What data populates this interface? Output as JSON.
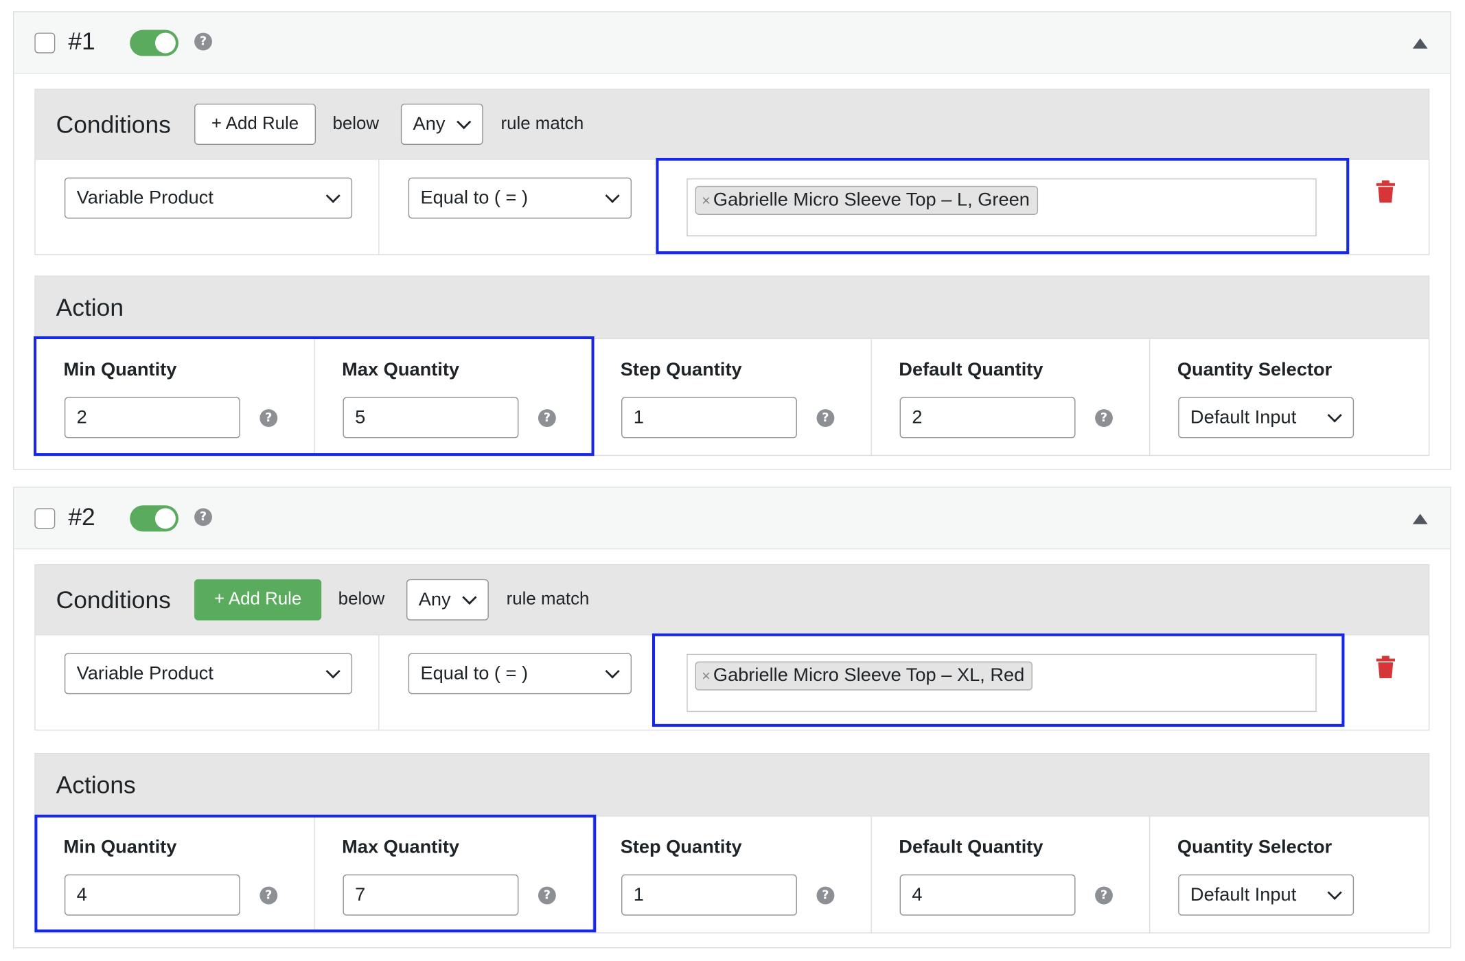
{
  "rules": [
    {
      "number": "#1",
      "enabled": true,
      "conditions": {
        "title": "Conditions",
        "add_rule_label": "+ Add Rule",
        "below_text": "below",
        "match_value": "Any",
        "rule_match_text": "rule match",
        "row": {
          "product_type": "Variable Product",
          "operator": "Equal to ( = )",
          "tags": [
            {
              "remove": "×",
              "label": "Gabrielle Micro Sleeve Top – L, Green"
            }
          ]
        }
      },
      "action": {
        "title": "Action",
        "fields": [
          {
            "label": "Min Quantity",
            "value": "2"
          },
          {
            "label": "Max Quantity",
            "value": "5"
          },
          {
            "label": "Step Quantity",
            "value": "1"
          },
          {
            "label": "Default Quantity",
            "value": "2"
          },
          {
            "label": "Quantity Selector",
            "value": "Default Input"
          }
        ]
      }
    },
    {
      "number": "#2",
      "enabled": true,
      "conditions": {
        "title": "Conditions",
        "add_rule_label": "+ Add Rule",
        "below_text": "below",
        "match_value": "Any",
        "rule_match_text": "rule match",
        "row": {
          "product_type": "Variable Product",
          "operator": "Equal to ( = )",
          "tags": [
            {
              "remove": "×",
              "label": "Gabrielle Micro Sleeve Top – XL, Red"
            }
          ]
        }
      },
      "action": {
        "title": "Actions",
        "fields": [
          {
            "label": "Min Quantity",
            "value": "4"
          },
          {
            "label": "Max Quantity",
            "value": "7"
          },
          {
            "label": "Step Quantity",
            "value": "1"
          },
          {
            "label": "Default Quantity",
            "value": "4"
          },
          {
            "label": "Quantity Selector",
            "value": "Default Input"
          }
        ]
      }
    }
  ],
  "help_glyph": "?",
  "colors": {
    "toggle_on": "#5aab5e",
    "add_rule_active": "#5aab5e",
    "highlight_border": "#1727e6",
    "delete_icon": "#d63638"
  },
  "icons": {
    "help": "question-circle-icon",
    "collapse": "triangle-up-icon",
    "delete": "trash-icon",
    "dropdown": "chevron-down-icon"
  }
}
